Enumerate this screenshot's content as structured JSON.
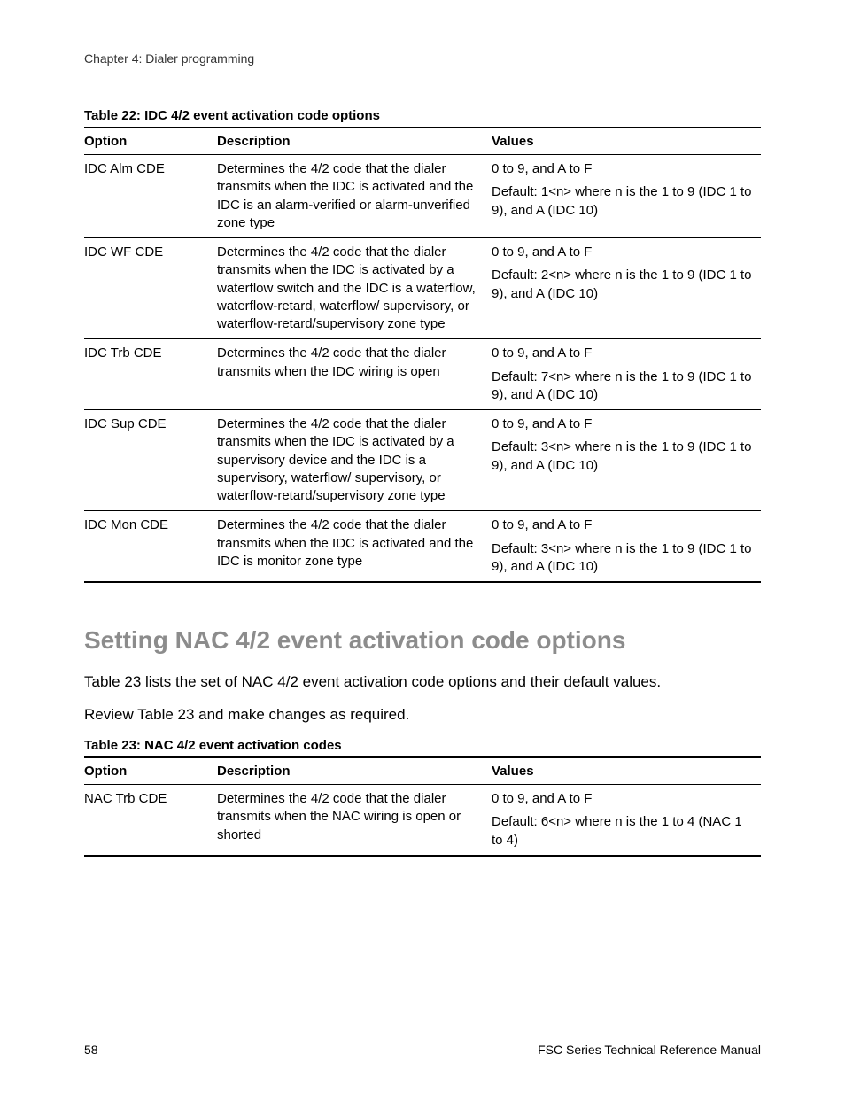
{
  "chapter_header": "Chapter 4: Dialer programming",
  "table22": {
    "caption": "Table 22: IDC 4/2 event activation code options",
    "head": {
      "option": "Option",
      "description": "Description",
      "values": "Values"
    },
    "rows": [
      {
        "option": "IDC Alm CDE",
        "description": "Determines the 4/2 code that the dialer transmits when the IDC is activated and the IDC is an alarm-verified or alarm-unverified zone type",
        "values_range": "0 to 9, and A to F",
        "values_default": "Default: 1<n> where n is the 1 to 9 (IDC 1 to 9), and A (IDC 10)"
      },
      {
        "option": "IDC WF CDE",
        "description": "Determines the 4/2 code that the dialer transmits when the IDC is activated by a waterflow switch and the IDC is a waterflow, waterflow-retard, waterflow/ supervisory, or waterflow-retard/supervisory zone type",
        "values_range": "0 to 9, and A to F",
        "values_default": "Default: 2<n> where n is the 1 to 9 (IDC 1 to 9), and A (IDC 10)"
      },
      {
        "option": "IDC Trb CDE",
        "description": "Determines the 4/2 code that the dialer transmits when the IDC wiring is open",
        "values_range": "0 to 9, and A to F",
        "values_default": "Default: 7<n> where n is the 1 to 9 (IDC 1 to 9), and A (IDC 10)"
      },
      {
        "option": "IDC Sup CDE",
        "description": "Determines the 4/2 code that the dialer transmits when the IDC is activated by a supervisory device and the IDC is a supervisory, waterflow/ supervisory, or waterflow-retard/supervisory zone type",
        "values_range": "0 to 9, and A to F",
        "values_default": "Default: 3<n> where n is the 1 to 9 (IDC 1 to 9), and A (IDC 10)"
      },
      {
        "option": "IDC Mon CDE",
        "description": "Determines the 4/2 code that the dialer transmits when the IDC is activated and the IDC is monitor zone type",
        "values_range": "0 to 9, and A to F",
        "values_default": "Default: 3<n> where n is the 1 to 9 (IDC 1 to 9), and A (IDC 10)"
      }
    ]
  },
  "section_heading": "Setting NAC 4/2 event activation code options",
  "body_para_1": "Table 23 lists the set of NAC 4/2 event activation code options and their default values.",
  "body_para_2": "Review Table 23 and make changes as required.",
  "table23": {
    "caption": "Table 23: NAC 4/2 event activation codes",
    "head": {
      "option": "Option",
      "description": "Description",
      "values": "Values"
    },
    "rows": [
      {
        "option": "NAC Trb CDE",
        "description": "Determines the 4/2 code that the dialer transmits when the NAC wiring is open or shorted",
        "values_range": "0 to 9, and A to F",
        "values_default": "Default: 6<n> where n is the 1 to 4 (NAC 1 to 4)"
      }
    ]
  },
  "footer": {
    "page_number": "58",
    "manual_title": "FSC Series Technical Reference Manual"
  }
}
